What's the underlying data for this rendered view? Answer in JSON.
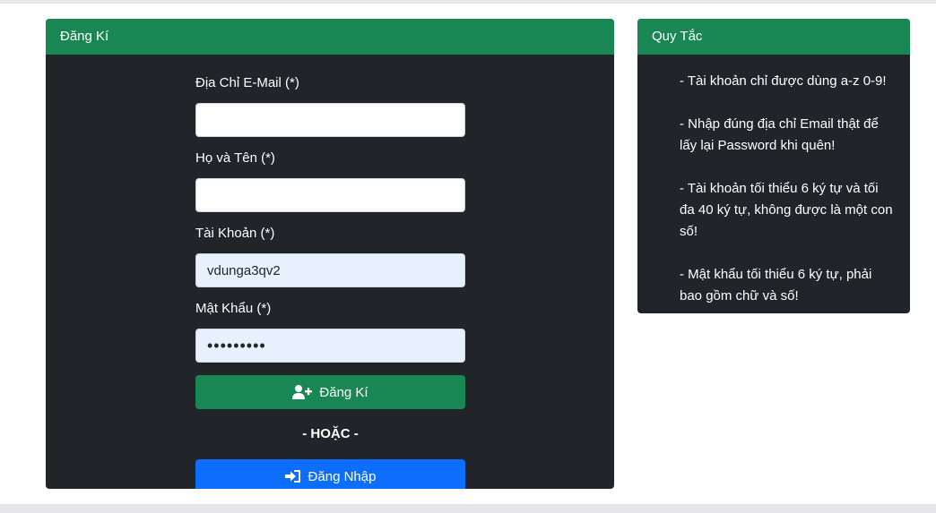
{
  "register": {
    "title": "Đăng Kí",
    "email_label": "Địa Chỉ E-Mail (*)",
    "email_value": "",
    "fullname_label": "Họ và Tên (*)",
    "fullname_value": "",
    "username_label": "Tài Khoản (*)",
    "username_value": "vdunga3qv2",
    "password_label": "Mật Khẩu (*)",
    "password_value": "•••••••••",
    "register_button": "Đăng Kí",
    "or_text": "- HOẶC -",
    "login_button": "Đăng Nhập"
  },
  "rules": {
    "title": "Quy Tắc",
    "items": [
      "- Tài khoản chỉ được dùng a-z 0-9!",
      "- Nhập đúng địa chỉ Email thật để lấy lại Password khi quên!",
      "- Tài khoản tối thiểu 6 ký tự và tối đa 40 ký tự, không được là một con số!",
      "- Mật khẩu tối thiểu 6 ký tự, phải bao gồm chữ và số!"
    ]
  },
  "icons": {
    "register_icon": "user-plus-icon",
    "login_icon": "sign-in-icon"
  },
  "colors": {
    "header_green": "#198754",
    "card_dark": "#212529",
    "login_blue": "#0d6efd",
    "autofill_bg": "#e8f0fe"
  }
}
